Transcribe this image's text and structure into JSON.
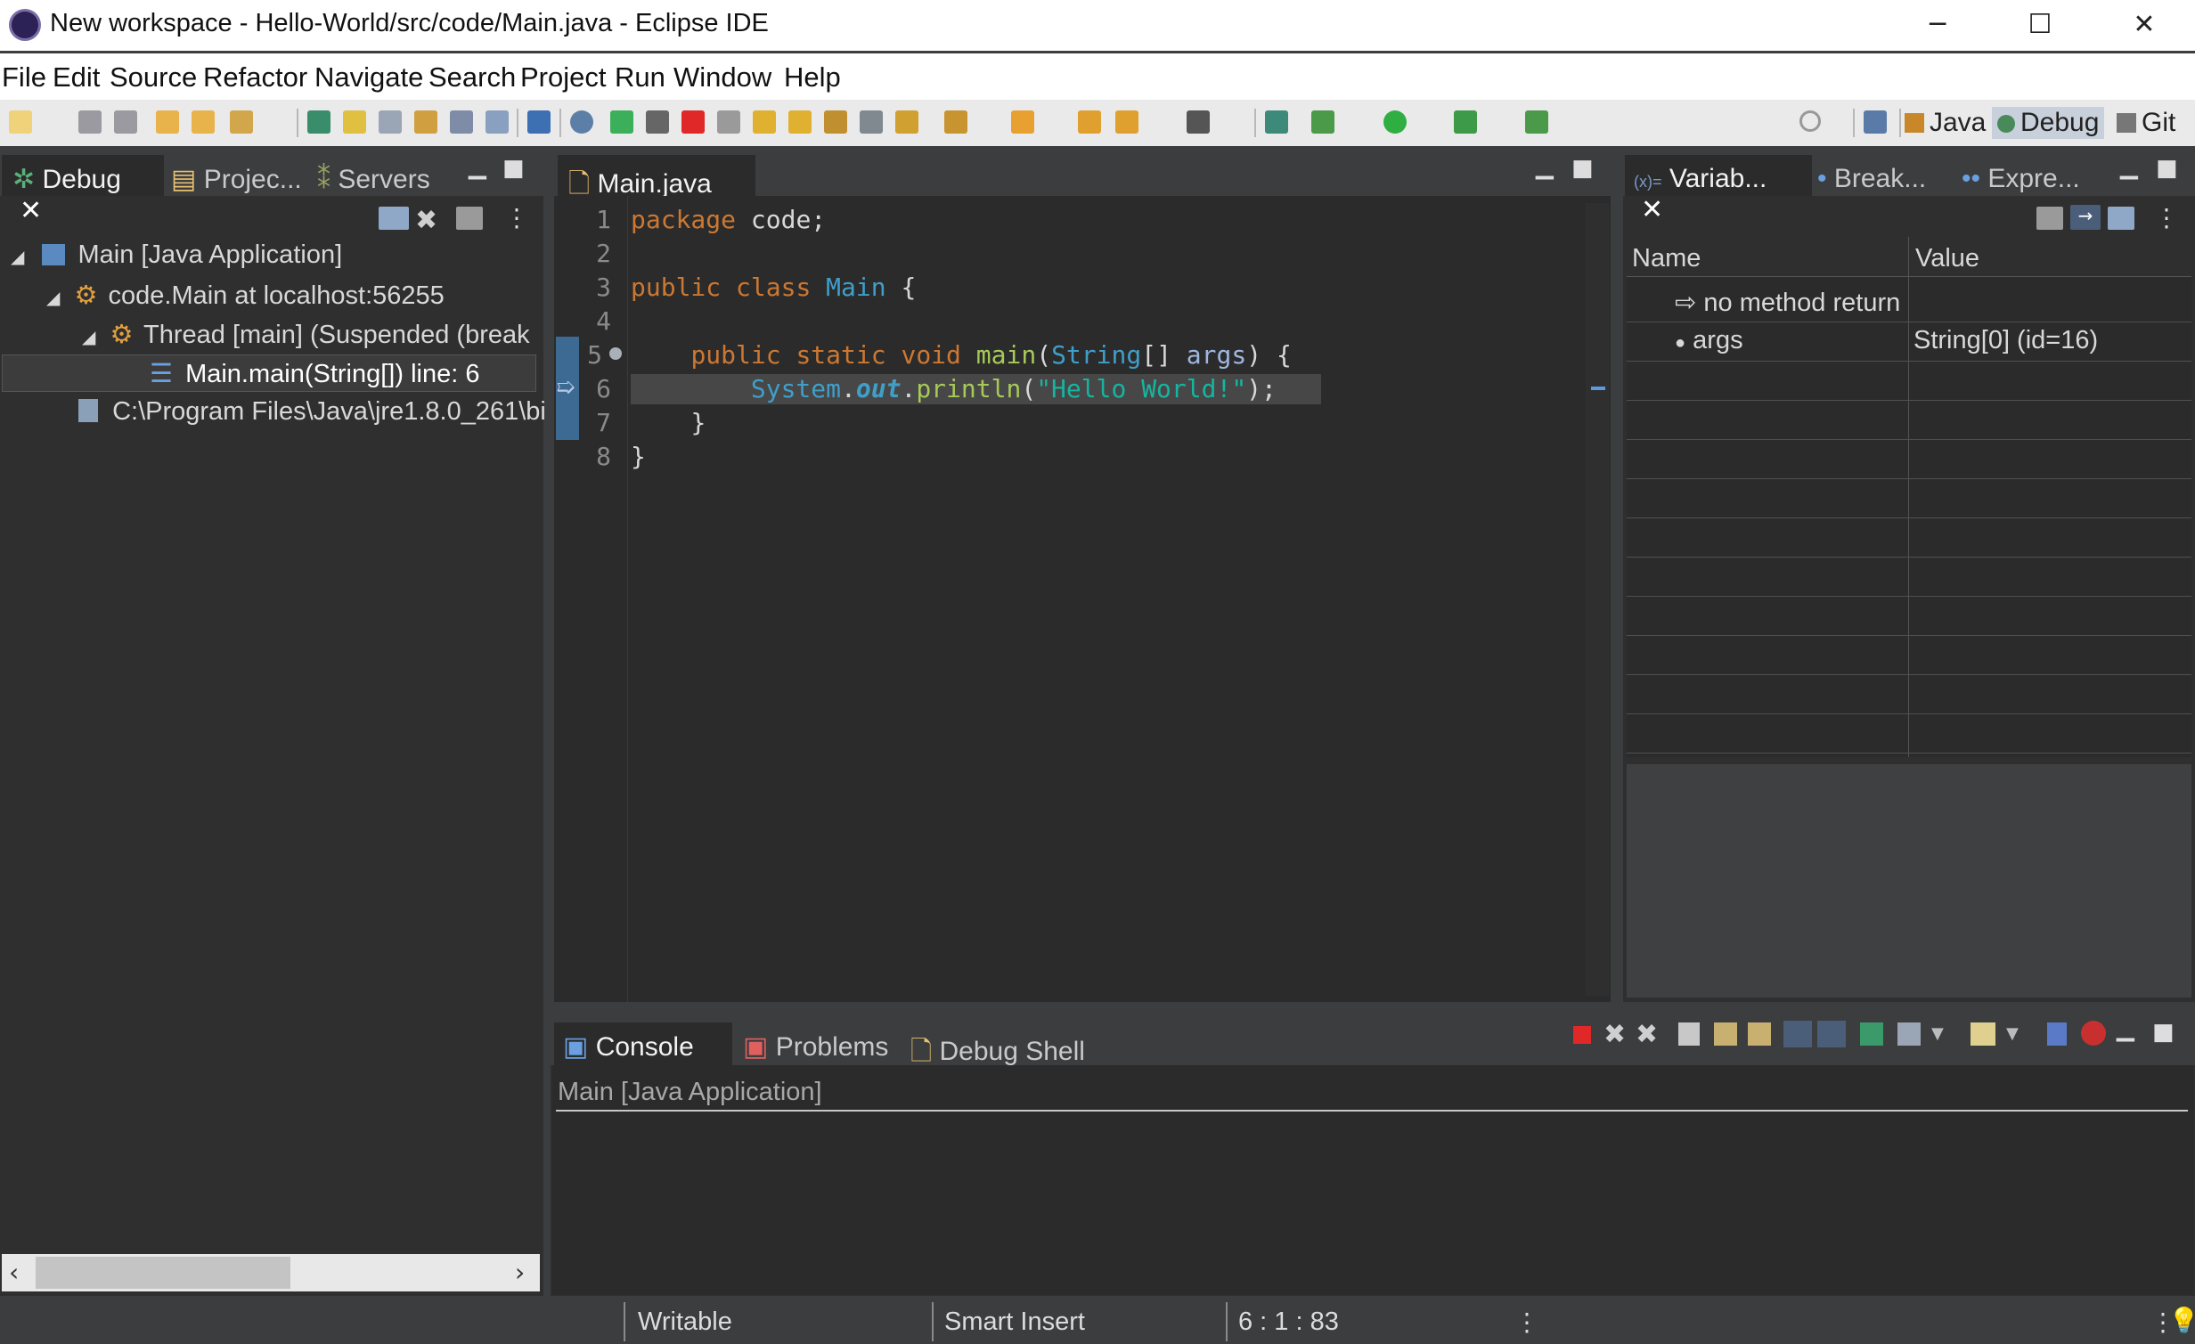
{
  "window": {
    "title": "New workspace - Hello-World/src/code/Main.java - Eclipse IDE",
    "minimize": "─",
    "maximize": "☐",
    "close": "✕"
  },
  "menu": [
    "File",
    "Edit",
    "Source",
    "Refactor",
    "Navigate",
    "Search",
    "Project",
    "Run",
    "Window",
    "Help"
  ],
  "perspectives": {
    "java": "Java",
    "debug": "Debug",
    "git": "Git"
  },
  "left_panel": {
    "tabs": [
      "Debug",
      "Projec...",
      "Servers"
    ],
    "tree": [
      "Main [Java Application]",
      "code.Main at localhost:56255",
      "Thread [main] (Suspended (break",
      "Main.main(String[]) line: 6",
      "C:\\Program Files\\Java\\jre1.8.0_261\\bi"
    ]
  },
  "editor": {
    "tab": "Main.java",
    "line_numbers": [
      "1",
      "2",
      "3",
      "4",
      "5",
      "6",
      "7",
      "8"
    ],
    "lines": {
      "l1": {
        "kw": "package",
        "rest": " code;"
      },
      "l3": {
        "kw1": "public",
        "kw2": "class",
        "cls": "Main",
        "rest": " {"
      },
      "l5": {
        "kw1": "public",
        "kw2": "static",
        "kw3": "void",
        "meth": "main",
        "p1": "(",
        "cls": "String",
        "p2": "[] ",
        "var": "args",
        "p3": ") {"
      },
      "l6": {
        "cls": "System",
        "dot1": ".",
        "fld": "out",
        "dot2": ".",
        "meth": "println",
        "p1": "(",
        "str": "\"Hello World!\"",
        "p2": ");"
      },
      "l7": "}",
      "l8": "}"
    }
  },
  "right_panel": {
    "tabs": [
      "Variab...",
      "Break...",
      "Expre..."
    ],
    "columns": [
      "Name",
      "Value"
    ],
    "rows": [
      {
        "name": "no method return",
        "value": ""
      },
      {
        "name": "args",
        "value": "String[0]  (id=16)"
      }
    ]
  },
  "console": {
    "tabs": [
      "Console",
      "Problems",
      "Debug Shell"
    ],
    "process": "Main [Java Application]"
  },
  "status": {
    "writable": "Writable",
    "insert_mode": "Smart Insert",
    "position": "6 : 1 : 83"
  }
}
